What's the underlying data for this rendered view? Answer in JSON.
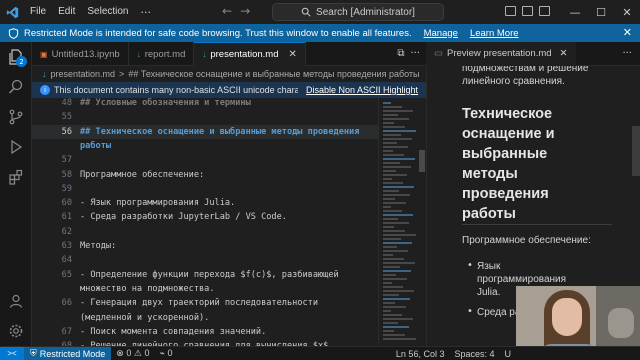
{
  "titlebar": {
    "menu": [
      "File",
      "Edit",
      "Selection"
    ],
    "more": "···",
    "search": "Search [Administrator]"
  },
  "restricted_banner": {
    "text": "Restricted Mode is intended for safe code browsing. Trust this window to enable all features.",
    "manage": "Manage",
    "learn_more": "Learn More"
  },
  "activity_bar": {
    "explorer_badge": "2"
  },
  "tabs": [
    {
      "label": "Untitled13.ipynb",
      "icon": "notebook-icon"
    },
    {
      "label": "report.md",
      "icon": "markdown-icon"
    },
    {
      "label": "presentation.md",
      "icon": "markdown-icon",
      "active": true
    }
  ],
  "breadcrumb": {
    "file": "presentation.md",
    "sep": ">",
    "symbol": "## Техническое оснащение и выбранные методы проведения работы"
  },
  "ascii_banner": {
    "text": "This document contains many non-basic ASCII unicode chara",
    "action": "Disable Non ASCII Highlight"
  },
  "editor": {
    "lines": [
      {
        "num": "48",
        "text": "## Условные обозначения и термины",
        "style": "heading"
      },
      {
        "num": "55",
        "text": "",
        "style": ""
      },
      {
        "num": "56",
        "text": "## Техническое оснащение и выбранные методы проведения",
        "style": "heading",
        "current": true
      },
      {
        "num": "",
        "text": "работы",
        "style": "heading"
      },
      {
        "num": "57",
        "text": "",
        "style": ""
      },
      {
        "num": "58",
        "text": "Программное обеспечение:",
        "style": ""
      },
      {
        "num": "59",
        "text": "",
        "style": ""
      },
      {
        "num": "60",
        "text": "- Язык программирования Julia.",
        "style": ""
      },
      {
        "num": "61",
        "text": "- Среда разработки JupyterLab / VS Code.",
        "style": ""
      },
      {
        "num": "62",
        "text": "",
        "style": ""
      },
      {
        "num": "63",
        "text": "Методы:",
        "style": ""
      },
      {
        "num": "64",
        "text": "",
        "style": ""
      },
      {
        "num": "65",
        "text": "- Определение функции перехода $f(c)$, разбивающей",
        "style": ""
      },
      {
        "num": "",
        "text": "множество на подмножества.",
        "style": ""
      },
      {
        "num": "66",
        "text": "- Генерация двух траекторий последовательности",
        "style": ""
      },
      {
        "num": "",
        "text": "(медленной и ускоренной).",
        "style": ""
      },
      {
        "num": "67",
        "text": "- Поиск момента совпадения значений.",
        "style": ""
      },
      {
        "num": "68",
        "text": "- Решение линейного сравнения для вычисления $x$.",
        "style": ""
      }
    ]
  },
  "preview": {
    "tab_label": "Preview presentation.md",
    "top_text": [
      "подмножествам и решение",
      "линейного сравнения."
    ],
    "heading": "Техническое оснащение и выбранные методы проведения работы",
    "software_label": "Программное обеспечение:",
    "bullets": [
      "Язык программирования Julia.",
      "Среда разработки Jupyter"
    ]
  },
  "statusbar": {
    "restricted": "Restricted Mode",
    "errors": "0",
    "warnings": "0",
    "ports": "0",
    "position": "Ln 56, Col 3",
    "spaces": "Spaces: 4",
    "encoding": "U"
  },
  "colors": {
    "accent": "#0078d4",
    "banner": "#0e639c",
    "heading": "#569cd6"
  }
}
